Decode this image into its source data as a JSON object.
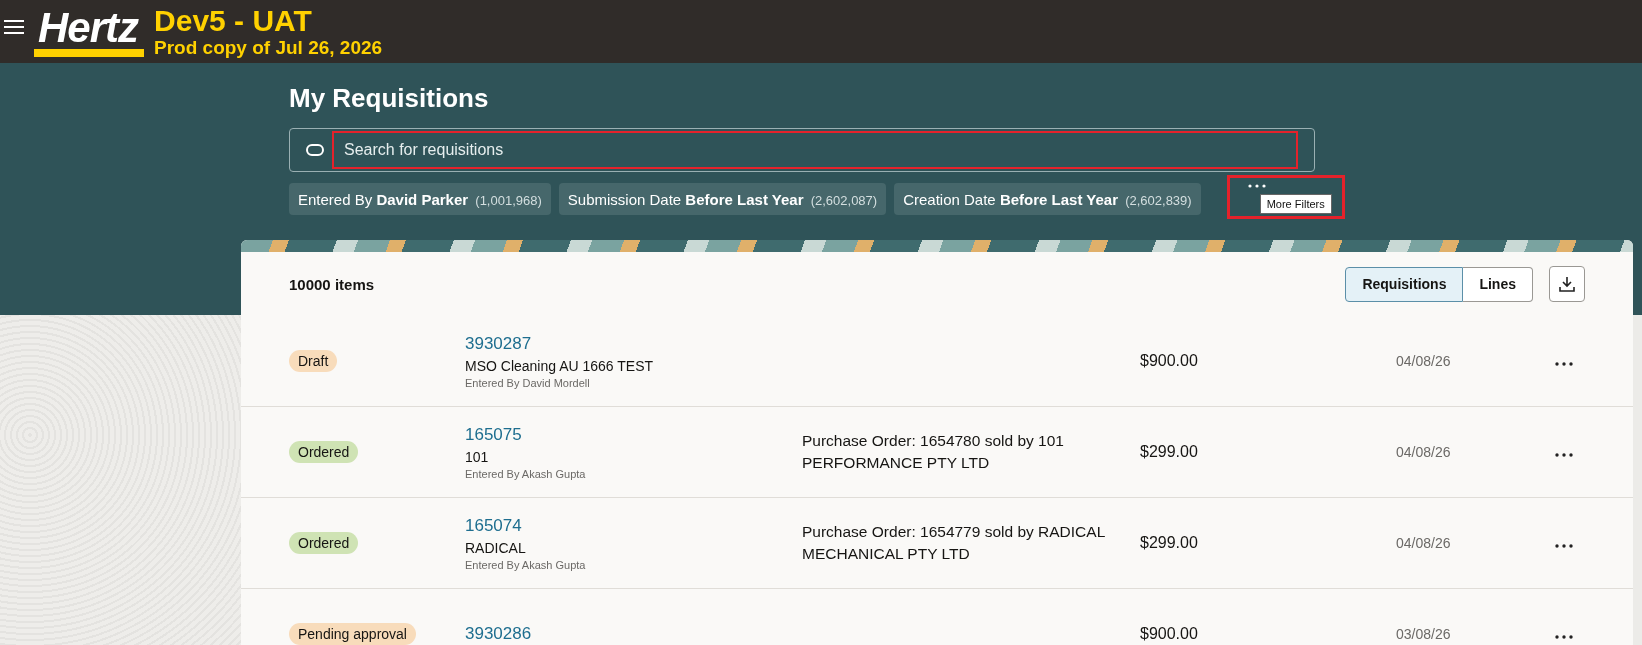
{
  "header": {
    "logo": "Hertz",
    "environment": "Dev5 - UAT",
    "subtitle": "Prod copy of Jul 26, 2026"
  },
  "page": {
    "title": "My Requisitions"
  },
  "search": {
    "placeholder": "Search for requisitions",
    "highlighted": true
  },
  "filters": [
    {
      "label": "Entered By",
      "value": "David Parker",
      "count": "(1,001,968)"
    },
    {
      "label": "Submission Date",
      "value": "Before Last Year",
      "count": "(2,602,087)"
    },
    {
      "label": "Creation Date",
      "value": "Before Last Year",
      "count": "(2,602,839)"
    }
  ],
  "more_filters": {
    "tooltip": "More Filters",
    "highlighted": true
  },
  "results": {
    "count": "10000 items",
    "views": [
      {
        "label": "Requisitions",
        "selected": true
      },
      {
        "label": "Lines",
        "selected": false
      }
    ]
  },
  "rows": [
    {
      "status": "Draft",
      "kind": "draft",
      "number": "3930287",
      "description": "MSO Cleaning AU 1666 TEST",
      "entered_by": "Entered By David Mordell",
      "order": "",
      "amount": "$900.00",
      "date": "04/08/26"
    },
    {
      "status": "Ordered",
      "kind": "ordered",
      "number": "165075",
      "description": "101",
      "entered_by": "Entered By Akash Gupta",
      "order": "Purchase Order: 1654780 sold by 101 PERFORMANCE PTY LTD",
      "amount": "$299.00",
      "date": "04/08/26"
    },
    {
      "status": "Ordered",
      "kind": "ordered",
      "number": "165074",
      "description": "RADICAL",
      "entered_by": "Entered By Akash Gupta",
      "order": "Purchase Order: 1654779 sold by RADICAL MECHANICAL PTY LTD",
      "amount": "$299.00",
      "date": "04/08/26"
    },
    {
      "status": "Pending approval",
      "kind": "pending",
      "number": "3930286",
      "description": "",
      "entered_by": "",
      "order": "",
      "amount": "$900.00",
      "date": "03/08/26"
    }
  ]
}
